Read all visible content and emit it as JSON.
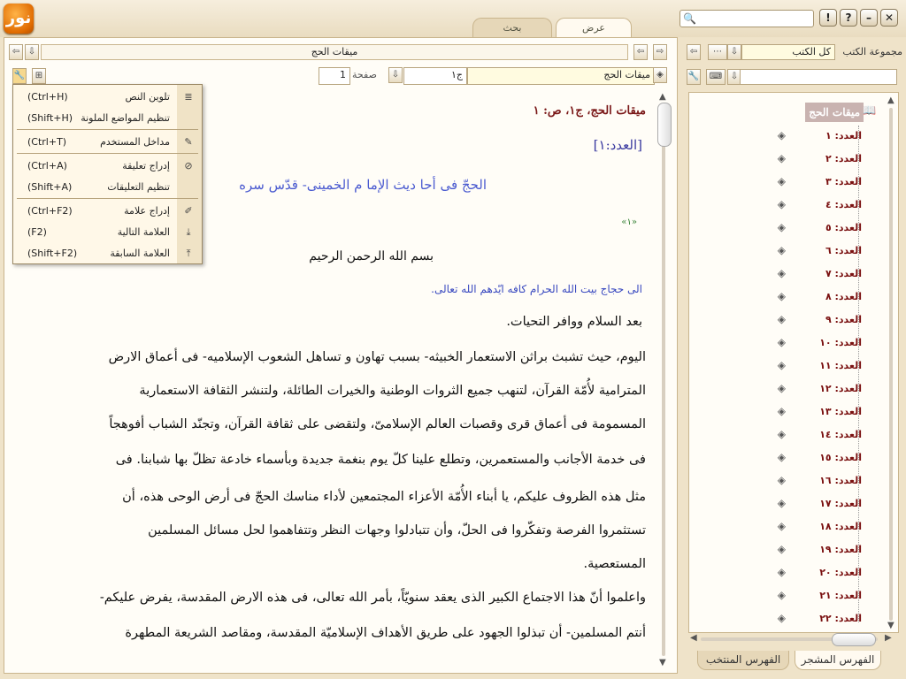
{
  "app": {
    "logo_text": "نور"
  },
  "tabs": [
    {
      "label": "عرض"
    },
    {
      "label": "بحث"
    }
  ],
  "window_buttons": {
    "help_exclaim": "!",
    "help_question": "?",
    "minimize": "–",
    "close": "✕"
  },
  "content": {
    "book_title": "ميقات الحج",
    "current_book": "ميقات الحج",
    "volume_value": "ج١",
    "page_label": "صفحة",
    "page_value": "1"
  },
  "menu": {
    "items": [
      {
        "label": "تلوين النص",
        "shortcut": "(Ctrl+H)"
      },
      {
        "label": "تنظيم المواضع الملونة",
        "shortcut": "(Shift+H)"
      },
      {
        "label": "مداخل المستخدم",
        "shortcut": "(Ctrl+T)"
      },
      {
        "label": "إدراج تعليقة",
        "shortcut": "(Ctrl+A)"
      },
      {
        "label": "تنظيم التعليقات",
        "shortcut": "(Shift+A)"
      },
      {
        "label": "إدراج علامة",
        "shortcut": "(Ctrl+F2)"
      },
      {
        "label": "العلامة التالية",
        "shortcut": "(F2)"
      },
      {
        "label": "العلامة السابقة",
        "shortcut": "(Shift+F2)"
      }
    ]
  },
  "document": {
    "heading": "ميقات الحج، ج١، ص: ١",
    "number_label": "[العدد:١]",
    "subtitle": "الحجّ فی أحا ديث الإما م الخمينی- قدّس سره",
    "footnote_marker": "«١»",
    "basmala": "بسم الله الرحمن الرحيم",
    "addressee": "الی حجاج بيت الله الحرام كافه ايّدهم الله تعالی.",
    "paragraph_lines": [
      "بعد السلام ووافر التحيات.",
      "اليوم، حيث تشبث براثن الاستعمار الخبيثه- بسبب تهاون و تساهل الشعوب الإسلاميه- فی أعماق الارض",
      "المترامية لأُمّة القرآن، لتنهب جميع الثروات الوطنية والخيرات الطائلة، ولتنشر الثقافة الاستعمارية",
      "المسمومة فی أعماق قرى وقصبات العالم الإسلامیّ، ولتقضى على ثقافة القرآن، وتجنّد الشباب أفوهجاً",
      "فی خدمة الأجانب والمستعمرين، وتطلع علينا كلّ يوم بنغمة جديدة وبأسماء خادعة تظلّ بها شبابنا. فی",
      "مثل هذه الظروف عليكم، يا أبناء الأُمّة الأعزاء المجتمعين لأداء مناسك الحجّ فی أرض الوحی هذه، أن",
      "تستثمروا الفرصة وتفكّروا فی الحلّ، وأن تتبادلوا وجهات النظر وتتفاهموا لحل مسائل المسلمين",
      "المستعصية.",
      "واعلموا أنّ هذا الاجتماع الكبير الذی يعقد سنويّاً، بأمر الله تعالی، فی هذه الارض المقدسة، يفرض عليكم-",
      "أنتم المسلمين- أن تبذلوا الجهود على طريق الأهداف الإسلاميّة المقدسة، ومقاصد الشريعة المطهرة"
    ]
  },
  "panel": {
    "collection_label": "مجموعة الكتب",
    "collection_value": "كل الكتب",
    "tree_root": "ميقات الحج",
    "tree_items": [
      "العدد: ١",
      "العدد: ٢",
      "العدد: ٣",
      "العدد: ٤",
      "العدد: ٥",
      "العدد: ٦",
      "العدد: ٧",
      "العدد: ٨",
      "العدد: ٩",
      "العدد: ١٠",
      "العدد: ١١",
      "العدد: ١٢",
      "العدد: ١٣",
      "العدد: ١٤",
      "العدد: ١٥",
      "العدد: ١٦",
      "العدد: ١٧",
      "العدد: ١٨",
      "العدد: ١٩",
      "العدد: ٢٠",
      "العدد: ٢١",
      "العدد: ٢٢"
    ],
    "bottom_tabs": [
      {
        "label": "الفهرس المشجر"
      },
      {
        "label": "الفهرس المنتخب"
      }
    ]
  }
}
